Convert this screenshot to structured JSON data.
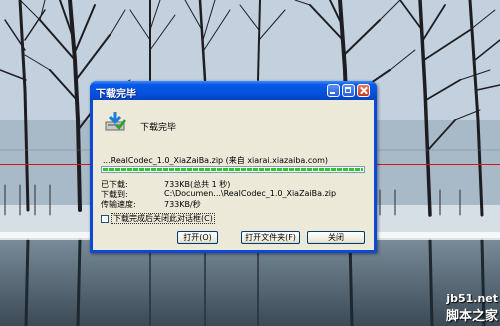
{
  "window": {
    "title": "下载完毕"
  },
  "dialog": {
    "status_label": "下载完毕",
    "source_line": "...RealCodec_1.0_XiaZaiBa.zip (来自 xiarai.xiazaiba.com)",
    "progress_fraction": 1.0,
    "rows": [
      {
        "key": "已下载:",
        "value": "733KB(总共 1 秒)"
      },
      {
        "key": "下载到:",
        "value": "C:\\Documen...\\RealCodec_1.0_XiaZaiBa.zip"
      },
      {
        "key": "传输速度:",
        "value": "733KB/秒"
      }
    ],
    "close_on_finish_label": "下载完成后关闭此对话框(C)",
    "close_on_finish_checked": false,
    "buttons": {
      "open": "打开(O)",
      "open_folder": "打开文件夹(F)",
      "close": "关闭"
    }
  },
  "watermark": {
    "url": "jb51.net",
    "name": "脚本之家"
  },
  "colors": {
    "titlebar": "#0a58e8",
    "client_bg": "#ece9d8",
    "progress": "#2ec82a",
    "redline": "#d01818"
  }
}
